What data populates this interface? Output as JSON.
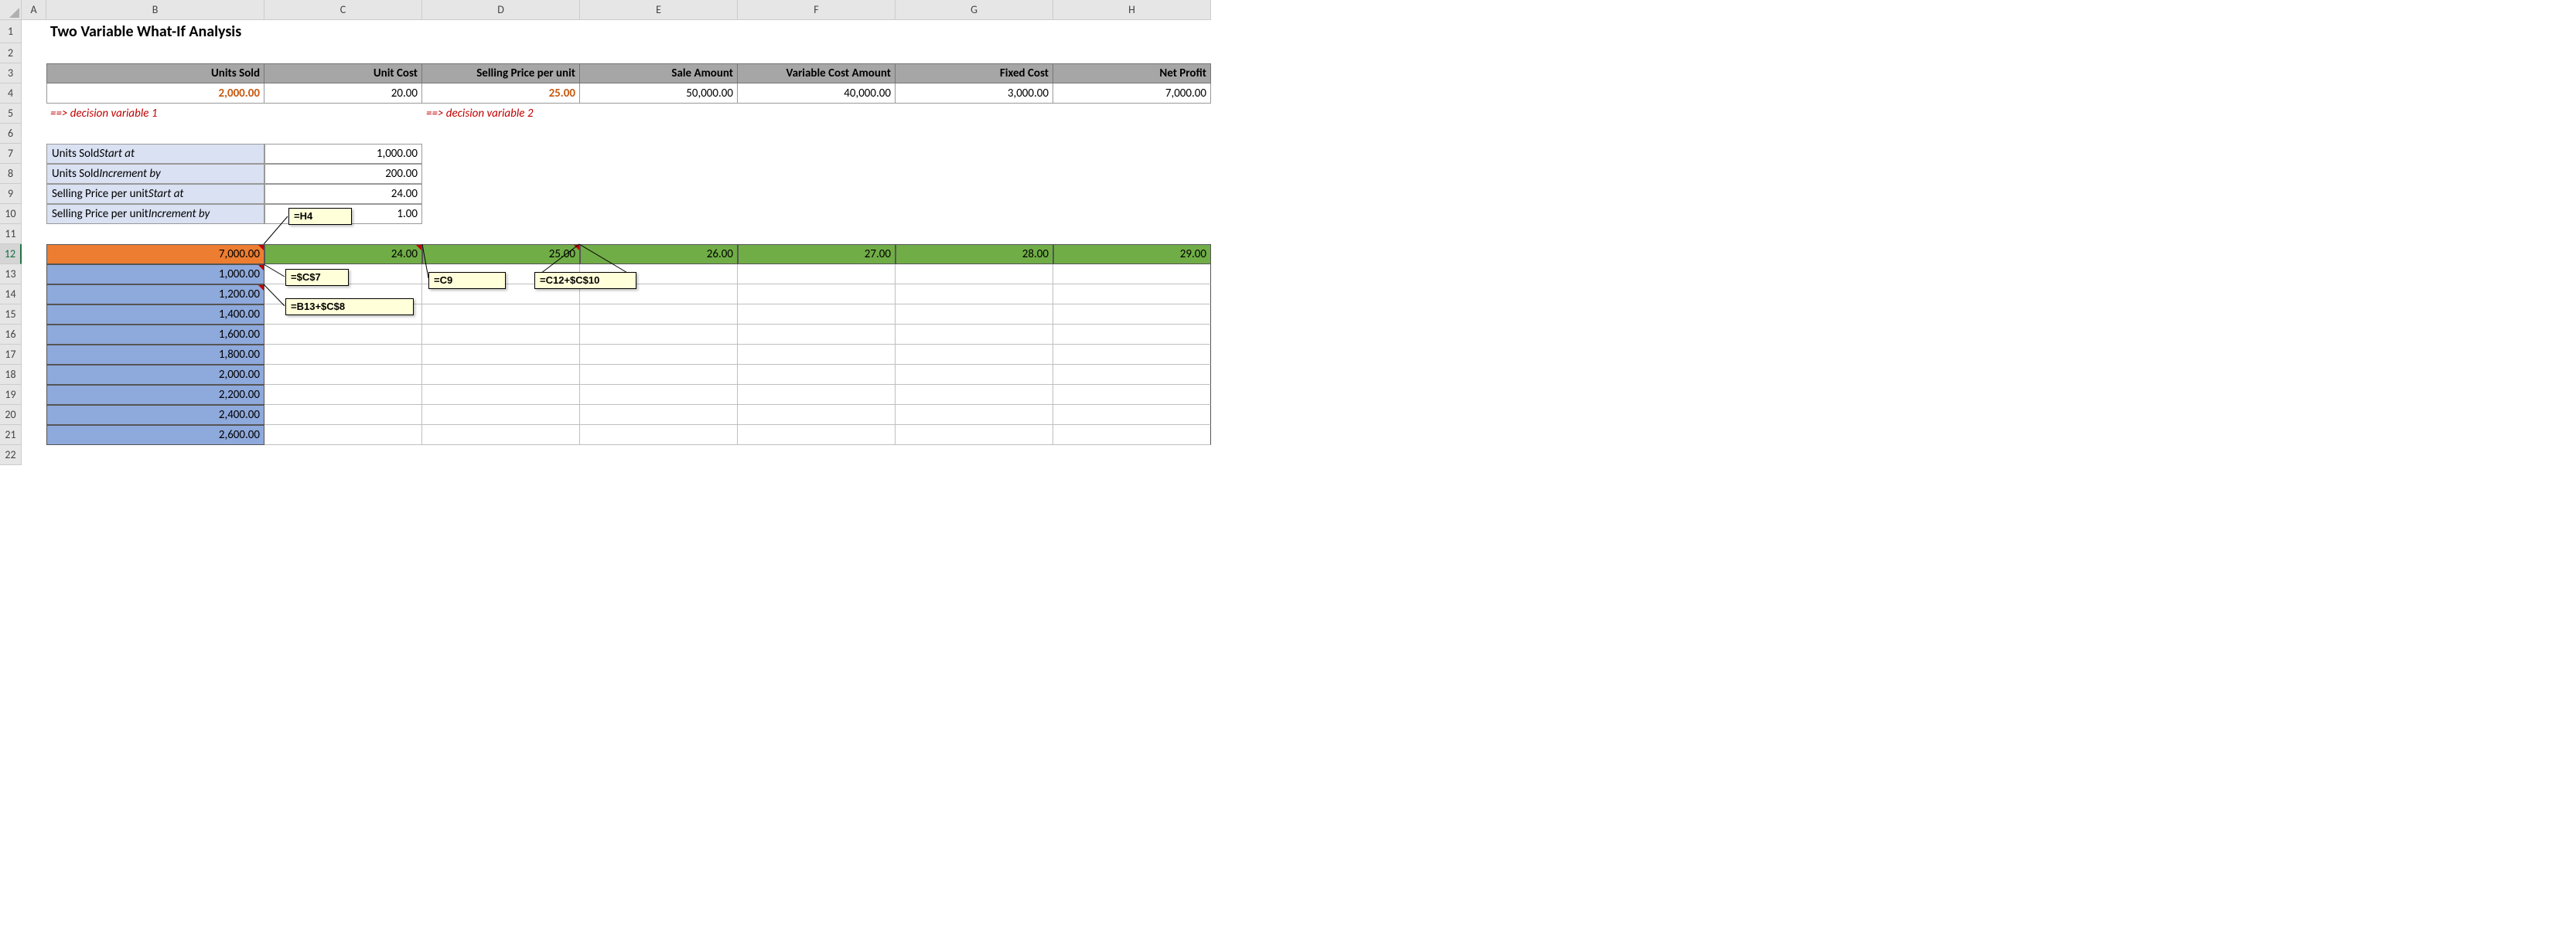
{
  "columns": [
    "A",
    "B",
    "C",
    "D",
    "E",
    "F",
    "G",
    "H"
  ],
  "rows": [
    "1",
    "2",
    "3",
    "4",
    "5",
    "6",
    "7",
    "8",
    "9",
    "10",
    "11",
    "12",
    "13",
    "14",
    "15",
    "16",
    "17",
    "18",
    "19",
    "20",
    "21",
    "22"
  ],
  "title": "Two Variable What-If Analysis",
  "headers": {
    "units_sold": "Units Sold",
    "unit_cost": "Unit Cost",
    "selling_price": "Selling Price per unit",
    "sale_amount": "Sale Amount",
    "var_cost": "Variable Cost Amount",
    "fixed_cost": "Fixed Cost",
    "net_profit": "Net Profit"
  },
  "values": {
    "units_sold": "2,000.00",
    "unit_cost": "20.00",
    "selling_price": "25.00",
    "sale_amount": "50,000.00",
    "var_cost": "40,000.00",
    "fixed_cost": "3,000.00",
    "net_profit": "7,000.00"
  },
  "dec1": "==> decision variable 1",
  "dec2": "==> decision variable 2",
  "params": {
    "us_start_a": "Units Sold ",
    "us_start_b": "Start at",
    "us_start_v": "1,000.00",
    "us_inc_a": "Units Sold ",
    "us_inc_b": "Increment by",
    "us_inc_v": "200.00",
    "sp_start_a": "Selling Price per unit ",
    "sp_start_b": "Start at",
    "sp_start_v": "24.00",
    "sp_inc_a": "Selling Price per unit ",
    "sp_inc_b": "Increment by",
    "sp_inc_v": "1.00"
  },
  "table": {
    "corner": "7,000.00",
    "col_headers": [
      "24.00",
      "25.00",
      "26.00",
      "27.00",
      "28.00",
      "29.00"
    ],
    "row_headers": [
      "1,000.00",
      "1,200.00",
      "1,400.00",
      "1,600.00",
      "1,800.00",
      "2,000.00",
      "2,200.00",
      "2,400.00",
      "2,600.00"
    ]
  },
  "callouts": {
    "h4": "=H4",
    "c7": "=$C$7",
    "b13": "=B13+$C$8",
    "c9": "=C9",
    "c12": "=C12+$C$10"
  },
  "chart_data": {
    "type": "table",
    "title": "Two Variable What-If Analysis",
    "inputs": {
      "Units Sold": 2000,
      "Unit Cost": 20,
      "Selling Price per unit": 25,
      "Sale Amount": 50000,
      "Variable Cost Amount": 40000,
      "Fixed Cost": 3000,
      "Net Profit": 7000
    },
    "what_if_row_variable": "Units Sold",
    "what_if_col_variable": "Selling Price per unit",
    "row_values": [
      1000,
      1200,
      1400,
      1600,
      1800,
      2000,
      2200,
      2400,
      2600
    ],
    "col_values": [
      24,
      25,
      26,
      27,
      28,
      29
    ],
    "output_formula_cell": "H4 (Net Profit)"
  }
}
